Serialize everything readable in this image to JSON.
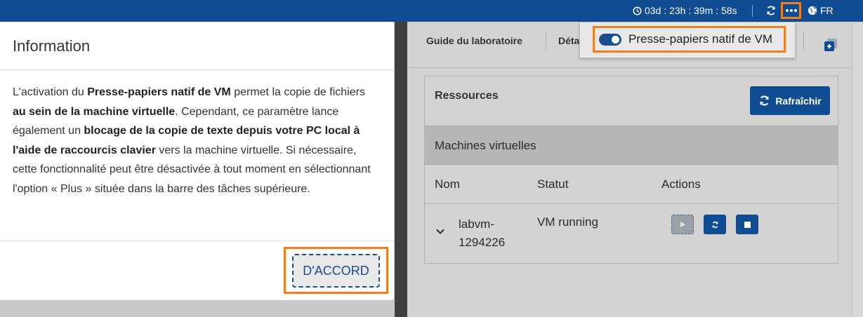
{
  "topbar": {
    "timer": "03d : 23h : 39m : 58s",
    "language": "FR",
    "icons": [
      "clock-icon",
      "refresh-icon",
      "more-icon",
      "globe-icon"
    ]
  },
  "tabs": {
    "guide": "Guide du laboratoire",
    "details": "Détails"
  },
  "dropdown": {
    "native_clipboard": "Presse-papiers natif de VM",
    "toggle_on": true
  },
  "resources": {
    "title": "Ressources",
    "refresh_label": "Rafraîchir",
    "vm_section": "Machines virtuelles",
    "columns": [
      "Nom",
      "Statut",
      "Actions"
    ],
    "vm": {
      "name_line1": "labvm-",
      "name_line2": "1294226",
      "status": "VM running"
    }
  },
  "modal": {
    "title": "Information",
    "body": {
      "p1": "L'activation du ",
      "b1": "Presse-papiers natif de VM",
      "p2": " permet la copie de fichiers ",
      "b2": "au sein de la machine virtuelle",
      "p3": ". Cependant, ce paramètre lance également un ",
      "b3": "blocage de la copie de texte depuis votre PC local à l'aide de raccourcis clavier",
      "p4": " vers la machine virtuelle. Si nécessaire, cette fonctionnalité peut être désactivée à tout moment en sélectionnant l'option « Plus » située dans la barre des tâches supérieure."
    },
    "ok_label": "D'ACCORD"
  },
  "colors": {
    "topbar": "#0f4c92",
    "highlight": "#f07f22",
    "primary_button": "#0f4c92"
  }
}
